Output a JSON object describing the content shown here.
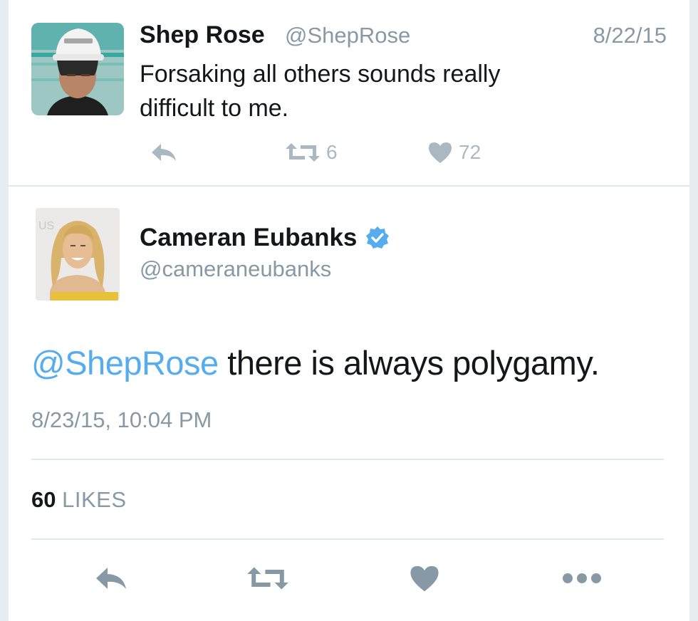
{
  "tweets": [
    {
      "name": "Shep Rose",
      "handle": "@ShepRose",
      "date": "8/22/15",
      "text_lines": [
        "Forsaking all others sounds really",
        "difficult to me."
      ],
      "retweets": "6",
      "likes": "72"
    }
  ],
  "main_tweet": {
    "name": "Cameran Eubanks",
    "handle": "@cameraneubanks",
    "mention": "@ShepRose",
    "text": " there is always polygamy.",
    "timestamp": "8/23/15, 10:04 PM",
    "likes_count": "60",
    "likes_label": "LIKES"
  },
  "icons": {
    "reply": "reply-icon",
    "retweet": "retweet-icon",
    "like": "heart-icon",
    "more": "more-dots-icon",
    "verified": "verified-badge-icon"
  },
  "colors": {
    "link_blue": "#55acee",
    "muted_gray": "#8899a6",
    "icon_gray": "#aab8c2",
    "icon_gray_dark": "#8899a6",
    "text": "#14171a",
    "divider": "#e1e8ed"
  }
}
